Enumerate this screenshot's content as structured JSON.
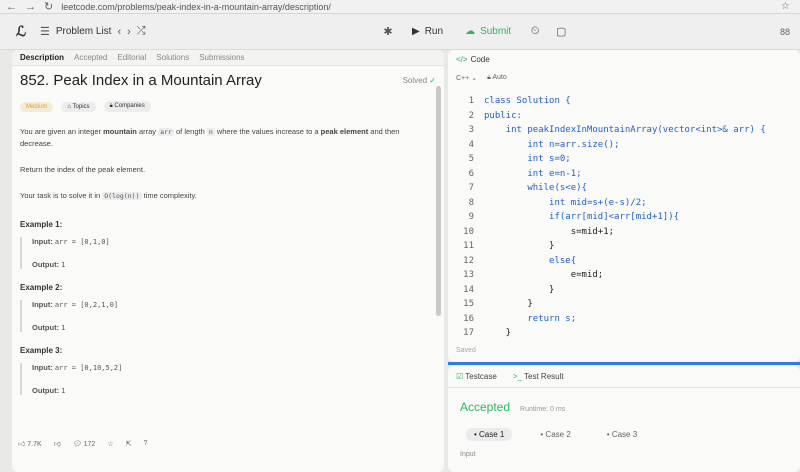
{
  "browser": {
    "url": "leetcode.com/problems/peak-index-in-a-mountain-array/description/"
  },
  "topbar": {
    "problem_list": "Problem List",
    "run": "Run",
    "submit": "Submit",
    "right_label": "88"
  },
  "tabs": [
    "Description",
    "Accepted",
    "Editorial",
    "Solutions",
    "Submissions"
  ],
  "problem": {
    "title": "852. Peak Index in a Mountain Array",
    "solved": "Solved",
    "difficulty": "Medium",
    "topics": "Topics",
    "companies": "Companies",
    "desc1_a": "You are given an integer ",
    "desc1_b": "mountain",
    "desc1_c": " array ",
    "desc1_code1": "arr",
    "desc1_d": " of length ",
    "desc1_code2": "n",
    "desc1_e": " where the values increase to a ",
    "desc1_f": "peak element",
    "desc1_g": " and then decrease.",
    "desc2": "Return the index of the peak element.",
    "desc3_a": "Your task is to solve it in ",
    "desc3_code": "O(log(n))",
    "desc3_b": " time complexity."
  },
  "examples": [
    {
      "title": "Example 1:",
      "input_label": "Input:",
      "input": "arr = [0,1,0]",
      "output_label": "Output:",
      "output": "1"
    },
    {
      "title": "Example 2:",
      "input_label": "Input:",
      "input": "arr = [0,2,1,0]",
      "output_label": "Output:",
      "output": "1"
    },
    {
      "title": "Example 3:",
      "input_label": "Input:",
      "input": "arr = [0,10,5,2]",
      "output_label": "Output:",
      "output": "1"
    }
  ],
  "stats": {
    "likes": "7.7K",
    "comments": "172"
  },
  "editor": {
    "tab": "Code",
    "language": "C++",
    "mode": "Auto",
    "saved": "Saved",
    "lines": [
      "class Solution {",
      "public:",
      "    int peakIndexInMountainArray(vector<int>& arr) {",
      "        int n=arr.size();",
      "        int s=0;",
      "        int e=n-1;",
      "        while(s<e){",
      "            int mid=s+(e-s)/2;",
      "            if(arr[mid]<arr[mid+1]){",
      "                s=mid+1;",
      "            }",
      "            else{",
      "                e=mid;",
      "            }",
      "        }",
      "        return s;",
      "    }"
    ]
  },
  "result": {
    "tab_testcase": "Testcase",
    "tab_result": "Test Result",
    "status": "Accepted",
    "runtime": "Runtime: 0 ms",
    "cases": [
      "Case 1",
      "Case 2",
      "Case 3"
    ],
    "input_label": "Input"
  }
}
